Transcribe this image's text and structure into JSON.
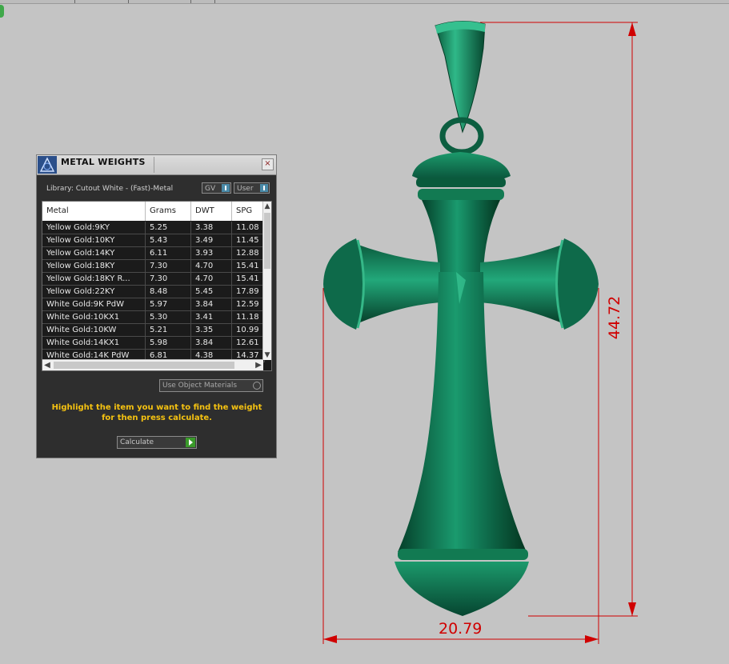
{
  "colors": {
    "background": "#c4c4c4",
    "model_green": "#0e6a4a",
    "dimension_red": "#d00000",
    "hint_yellow": "#f5c211"
  },
  "panel": {
    "title": "METAL WEIGHTS",
    "close_icon": "×",
    "library_label": "Library: Cutout White - (Fast)-Metal",
    "gv_label": "GV",
    "user_label": "User",
    "columns": [
      "Metal",
      "Grams",
      "DWT",
      "SPG"
    ],
    "rows": [
      [
        "Yellow Gold:9KY",
        "5.25",
        "3.38",
        "11.08"
      ],
      [
        "Yellow Gold:10KY",
        "5.43",
        "3.49",
        "11.45"
      ],
      [
        "Yellow Gold:14KY",
        "6.11",
        "3.93",
        "12.88"
      ],
      [
        "Yellow Gold:18KY",
        "7.30",
        "4.70",
        "15.41"
      ],
      [
        "Yellow Gold:18KY R...",
        "7.30",
        "4.70",
        "15.41"
      ],
      [
        "Yellow Gold:22KY",
        "8.48",
        "5.45",
        "17.89"
      ],
      [
        "White Gold:9K PdW",
        "5.97",
        "3.84",
        "12.59"
      ],
      [
        "White Gold:10KX1",
        "5.30",
        "3.41",
        "11.18"
      ],
      [
        "White Gold:10KW",
        "5.21",
        "3.35",
        "10.99"
      ],
      [
        "White Gold:14KX1",
        "5.98",
        "3.84",
        "12.61"
      ],
      [
        "White Gold:14K PdW",
        "6.81",
        "4.38",
        "14.37"
      ]
    ],
    "use_object_materials": "Use Object Materials",
    "hint": "Highlight the item you want to find the weight for then press calculate.",
    "calculate_label": "Calculate"
  },
  "dimensions": {
    "height": "44.72",
    "width": "20.79"
  }
}
